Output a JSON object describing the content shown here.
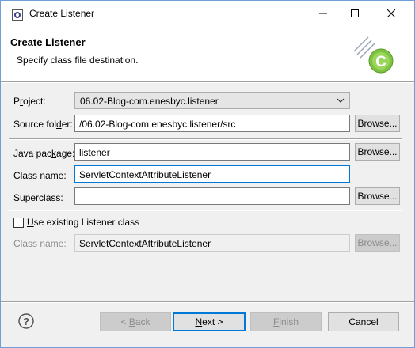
{
  "window": {
    "title": "Create Listener"
  },
  "banner": {
    "title": "Create Listener",
    "subtitle": "Specify class file destination."
  },
  "form": {
    "project": {
      "label_pre": "P",
      "label_u": "r",
      "label_post": "oject:",
      "value": "06.02-Blog-com.enesbyc.listener"
    },
    "source_folder": {
      "label_pre": "Source fol",
      "label_u": "d",
      "label_post": "er:",
      "value": "/06.02-Blog-com.enesbyc.listener/src",
      "browse": "Browse..."
    },
    "java_package": {
      "label_pre": "Java pac",
      "label_u": "k",
      "label_post": "age:",
      "value": "listener",
      "browse": "Browse..."
    },
    "class_name": {
      "label": "Class name:",
      "value": "ServletContextAttributeListener"
    },
    "superclass": {
      "label_pre": "",
      "label_u": "S",
      "label_post": "uperclass:",
      "value": "",
      "browse": "Browse..."
    },
    "use_existing": {
      "label_pre": "",
      "label_u": "U",
      "label_post": "se existing Listener class",
      "checked": false
    },
    "existing_class_name": {
      "label_pre": "Class na",
      "label_u": "m",
      "label_post": "e:",
      "value": "ServletContextAttributeListener",
      "browse": "Browse..."
    }
  },
  "footer": {
    "back": {
      "pre": "< ",
      "u": "B",
      "post": "ack"
    },
    "next": {
      "pre": "",
      "u": "N",
      "post": "ext >"
    },
    "finish": {
      "pre": "",
      "u": "F",
      "post": "inish"
    },
    "cancel": "Cancel"
  },
  "colors": {
    "accent": "#0078d7",
    "wizard_green": "#7ec242"
  }
}
